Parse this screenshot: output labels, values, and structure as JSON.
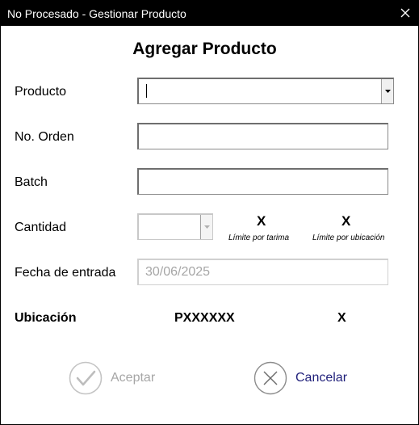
{
  "window": {
    "title": "No Procesado - Gestionar Producto"
  },
  "form": {
    "heading": "Agregar Producto",
    "producto_label": "Producto",
    "producto_value": "",
    "orden_label": "No. Orden",
    "orden_value": "",
    "batch_label": "Batch",
    "batch_value": "",
    "cantidad_label": "Cantidad",
    "cantidad_value": "",
    "limite_tarima_value": "X",
    "limite_tarima_label": "Límite por tarima",
    "limite_ubicacion_value": "X",
    "limite_ubicacion_label": "Límite por ubicación",
    "fecha_label": "Fecha de entrada",
    "fecha_value": "30/06/2025",
    "ubicacion_label": "Ubicación",
    "ubicacion_value": "PXXXXXX",
    "ubicacion_extra": "X"
  },
  "buttons": {
    "aceptar_label": "Aceptar",
    "cancelar_label": "Cancelar"
  },
  "colors": {
    "titlebar": "#000000",
    "disabled_text": "#a6a6a6",
    "cancel_text": "#1f1f7a"
  }
}
